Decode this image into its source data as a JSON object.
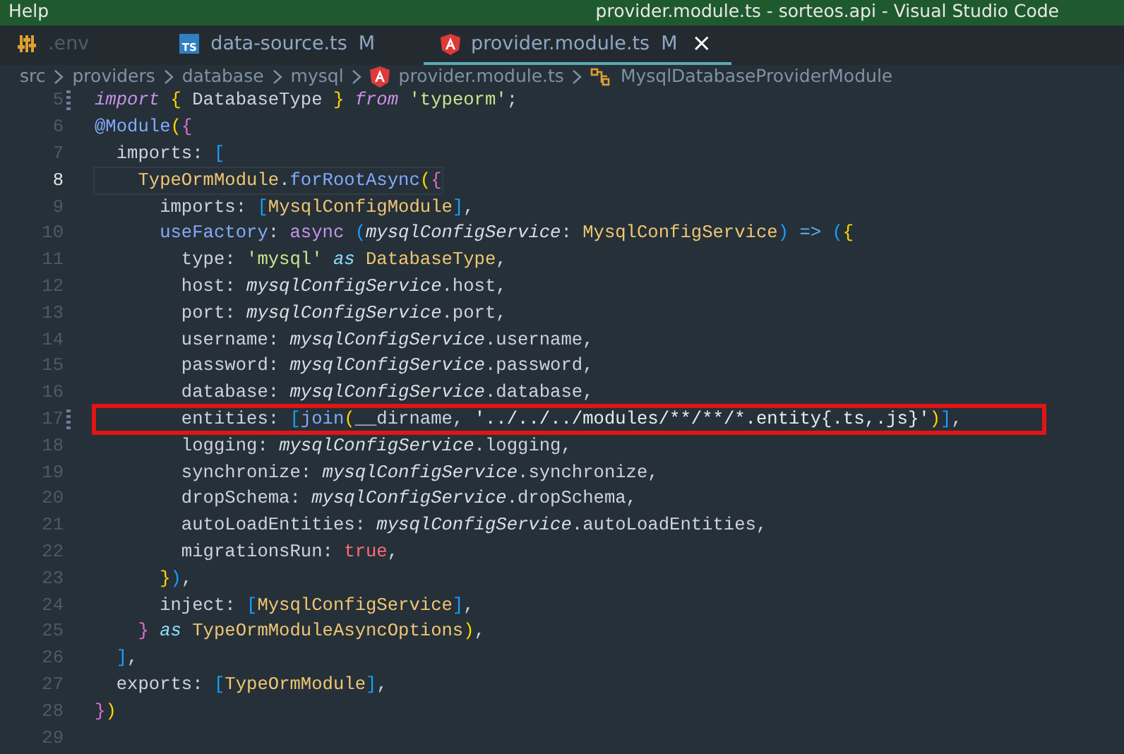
{
  "title_bar": {
    "menu": "Help",
    "title": "provider.module.ts - sorteos.api - Visual Studio Code"
  },
  "tabs": [
    {
      "label": ".env",
      "kind": "env",
      "dimmed": true,
      "selected": false
    },
    {
      "label": "data-source.ts",
      "kind": "typescript",
      "icon_text": "TS",
      "badge": "M",
      "dimmed": false,
      "selected": false
    },
    {
      "label": "provider.module.ts",
      "kind": "angular",
      "badge": "M",
      "dimmed": false,
      "selected": true,
      "close": "×"
    }
  ],
  "breadcrumb": [
    {
      "label": "src",
      "kind": "folder"
    },
    {
      "label": "providers",
      "kind": "folder"
    },
    {
      "label": "database",
      "kind": "folder"
    },
    {
      "label": "mysql",
      "kind": "folder"
    },
    {
      "label": "provider.module.ts",
      "kind": "file"
    },
    {
      "label": "MysqlDatabaseProviderModule",
      "kind": "symbol"
    }
  ],
  "editor": {
    "lines": [
      {
        "num": "5",
        "current": false,
        "modified": true,
        "highlighted": false,
        "tokens": [
          {
            "text": "import ",
            "kind": "keyword"
          },
          {
            "text": "{ ",
            "kind": "brace1"
          },
          {
            "text": "DatabaseType ",
            "kind": "plain"
          },
          {
            "text": "} ",
            "kind": "brace1"
          },
          {
            "text": "from ",
            "kind": "keyword"
          },
          {
            "text": "'typeorm'",
            "kind": "string"
          },
          {
            "text": ";",
            "kind": "plain"
          }
        ]
      },
      {
        "num": "6",
        "current": false,
        "modified": false,
        "highlighted": false,
        "tokens": [
          {
            "text": "@Module",
            "kind": "function"
          },
          {
            "text": "(",
            "kind": "brace1"
          },
          {
            "text": "{",
            "kind": "brace2"
          }
        ]
      },
      {
        "num": "7",
        "current": false,
        "modified": false,
        "highlighted": false,
        "tokens": [
          {
            "text": "  imports: ",
            "kind": "plain"
          },
          {
            "text": "[",
            "kind": "brace3"
          }
        ]
      },
      {
        "num": "8",
        "current": true,
        "modified": false,
        "highlighted": false,
        "tokens": [
          {
            "text": "    TypeOrmModule",
            "kind": "type"
          },
          {
            "text": ".",
            "kind": "plain"
          },
          {
            "text": "forRootAsync",
            "kind": "function"
          },
          {
            "text": "(",
            "kind": "brace1"
          },
          {
            "text": "{",
            "kind": "brace2"
          }
        ]
      },
      {
        "num": "9",
        "current": false,
        "modified": false,
        "highlighted": false,
        "tokens": [
          {
            "text": "      imports: ",
            "kind": "plain"
          },
          {
            "text": "[",
            "kind": "brace3"
          },
          {
            "text": "MysqlConfigModule",
            "kind": "type"
          },
          {
            "text": "]",
            "kind": "brace3"
          },
          {
            "text": ",",
            "kind": "plain"
          }
        ]
      },
      {
        "num": "10",
        "current": false,
        "modified": false,
        "highlighted": false,
        "tokens": [
          {
            "text": "      useFactory",
            "kind": "function"
          },
          {
            "text": ": ",
            "kind": "plain"
          },
          {
            "text": "async ",
            "kind": "storage"
          },
          {
            "text": "(",
            "kind": "brace3"
          },
          {
            "text": "mysqlConfigService",
            "kind": "variable"
          },
          {
            "text": ": ",
            "kind": "plain"
          },
          {
            "text": "MysqlConfigService",
            "kind": "type"
          },
          {
            "text": ")",
            "kind": "brace3"
          },
          {
            "text": " => ",
            "kind": "operator"
          },
          {
            "text": "(",
            "kind": "brace3"
          },
          {
            "text": "{",
            "kind": "brace1"
          }
        ]
      },
      {
        "num": "11",
        "current": false,
        "modified": false,
        "highlighted": false,
        "tokens": [
          {
            "text": "        type: ",
            "kind": "plain"
          },
          {
            "text": "'mysql'",
            "kind": "string"
          },
          {
            "text": " as ",
            "kind": "cast"
          },
          {
            "text": "DatabaseType",
            "kind": "type"
          },
          {
            "text": ",",
            "kind": "plain"
          }
        ]
      },
      {
        "num": "12",
        "current": false,
        "modified": false,
        "highlighted": false,
        "tokens": [
          {
            "text": "        host: ",
            "kind": "plain"
          },
          {
            "text": "mysqlConfigService",
            "kind": "variable"
          },
          {
            "text": ".host,",
            "kind": "plain"
          }
        ]
      },
      {
        "num": "13",
        "current": false,
        "modified": false,
        "highlighted": false,
        "tokens": [
          {
            "text": "        port: ",
            "kind": "plain"
          },
          {
            "text": "mysqlConfigService",
            "kind": "variable"
          },
          {
            "text": ".port,",
            "kind": "plain"
          }
        ]
      },
      {
        "num": "14",
        "current": false,
        "modified": false,
        "highlighted": false,
        "tokens": [
          {
            "text": "        username: ",
            "kind": "plain"
          },
          {
            "text": "mysqlConfigService",
            "kind": "variable"
          },
          {
            "text": ".username,",
            "kind": "plain"
          }
        ]
      },
      {
        "num": "15",
        "current": false,
        "modified": false,
        "highlighted": false,
        "tokens": [
          {
            "text": "        password: ",
            "kind": "plain"
          },
          {
            "text": "mysqlConfigService",
            "kind": "variable"
          },
          {
            "text": ".password,",
            "kind": "plain"
          }
        ]
      },
      {
        "num": "16",
        "current": false,
        "modified": false,
        "highlighted": false,
        "tokens": [
          {
            "text": "        database: ",
            "kind": "plain"
          },
          {
            "text": "mysqlConfigService",
            "kind": "variable"
          },
          {
            "text": ".database,",
            "kind": "plain"
          }
        ]
      },
      {
        "num": "17",
        "current": false,
        "modified": true,
        "highlighted": true,
        "tokens": [
          {
            "text": "        entities: ",
            "kind": "plain"
          },
          {
            "text": "[",
            "kind": "brace3"
          },
          {
            "text": "join",
            "kind": "function"
          },
          {
            "text": "(",
            "kind": "brace1"
          },
          {
            "text": "__dirname, ",
            "kind": "plain"
          },
          {
            "text": "'../../../modules/**/**/*.entity{.ts,.js}'",
            "kind": "path"
          },
          {
            "text": ")",
            "kind": "brace1"
          },
          {
            "text": "]",
            "kind": "brace3"
          },
          {
            "text": ",",
            "kind": "plain"
          }
        ]
      },
      {
        "num": "18",
        "current": false,
        "modified": false,
        "highlighted": false,
        "tokens": [
          {
            "text": "        logging: ",
            "kind": "plain"
          },
          {
            "text": "mysqlConfigService",
            "kind": "variable"
          },
          {
            "text": ".logging,",
            "kind": "plain"
          }
        ]
      },
      {
        "num": "19",
        "current": false,
        "modified": false,
        "highlighted": false,
        "tokens": [
          {
            "text": "        synchronize: ",
            "kind": "plain"
          },
          {
            "text": "mysqlConfigService",
            "kind": "variable"
          },
          {
            "text": ".synchronize,",
            "kind": "plain"
          }
        ]
      },
      {
        "num": "20",
        "current": false,
        "modified": false,
        "highlighted": false,
        "tokens": [
          {
            "text": "        dropSchema: ",
            "kind": "plain"
          },
          {
            "text": "mysqlConfigService",
            "kind": "variable"
          },
          {
            "text": ".dropSchema,",
            "kind": "plain"
          }
        ]
      },
      {
        "num": "21",
        "current": false,
        "modified": false,
        "highlighted": false,
        "tokens": [
          {
            "text": "        autoLoadEntities: ",
            "kind": "plain"
          },
          {
            "text": "mysqlConfigService",
            "kind": "variable"
          },
          {
            "text": ".autoLoadEntities,",
            "kind": "plain"
          }
        ]
      },
      {
        "num": "22",
        "current": false,
        "modified": false,
        "highlighted": false,
        "tokens": [
          {
            "text": "        migrationsRun: ",
            "kind": "plain"
          },
          {
            "text": "true",
            "kind": "boolean"
          },
          {
            "text": ",",
            "kind": "plain"
          }
        ]
      },
      {
        "num": "23",
        "current": false,
        "modified": false,
        "highlighted": false,
        "tokens": [
          {
            "text": "      }",
            "kind": "brace1"
          },
          {
            "text": ")",
            "kind": "brace3"
          },
          {
            "text": ",",
            "kind": "plain"
          }
        ]
      },
      {
        "num": "24",
        "current": false,
        "modified": false,
        "highlighted": false,
        "tokens": [
          {
            "text": "      inject: ",
            "kind": "plain"
          },
          {
            "text": "[",
            "kind": "brace3"
          },
          {
            "text": "MysqlConfigService",
            "kind": "type"
          },
          {
            "text": "]",
            "kind": "brace3"
          },
          {
            "text": ",",
            "kind": "plain"
          }
        ]
      },
      {
        "num": "25",
        "current": false,
        "modified": false,
        "highlighted": false,
        "tokens": [
          {
            "text": "    }",
            "kind": "brace2"
          },
          {
            "text": " as ",
            "kind": "cast"
          },
          {
            "text": "TypeOrmModuleAsyncOptions",
            "kind": "type"
          },
          {
            "text": ")",
            "kind": "brace1"
          },
          {
            "text": ",",
            "kind": "plain"
          }
        ]
      },
      {
        "num": "26",
        "current": false,
        "modified": false,
        "highlighted": false,
        "tokens": [
          {
            "text": "  ]",
            "kind": "brace3"
          },
          {
            "text": ",",
            "kind": "plain"
          }
        ]
      },
      {
        "num": "27",
        "current": false,
        "modified": false,
        "highlighted": false,
        "tokens": [
          {
            "text": "  exports: ",
            "kind": "plain"
          },
          {
            "text": "[",
            "kind": "brace3"
          },
          {
            "text": "TypeOrmModule",
            "kind": "type"
          },
          {
            "text": "]",
            "kind": "brace3"
          },
          {
            "text": ",",
            "kind": "plain"
          }
        ]
      },
      {
        "num": "28",
        "current": false,
        "modified": false,
        "highlighted": false,
        "tokens": [
          {
            "text": "}",
            "kind": "brace2"
          },
          {
            "text": ")",
            "kind": "brace1"
          }
        ]
      },
      {
        "num": "29",
        "current": false,
        "modified": false,
        "highlighted": false
      }
    ]
  }
}
